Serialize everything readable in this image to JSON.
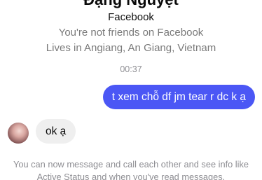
{
  "profile": {
    "name": "Đặng Nguyệt",
    "source": "Facebook",
    "friend_status": "You're not friends on Facebook",
    "location": "Lives in Angiang, An Giang, Vietnam"
  },
  "conversation": {
    "timestamp": "00:37",
    "messages": [
      {
        "direction": "outgoing",
        "text": "t xem chỗ df jm tear r dc k ạ"
      },
      {
        "direction": "incoming",
        "text": "ok ạ"
      }
    ]
  },
  "notice": {
    "text": "You can now message and call each other and see info like Active Status and when you've read messages."
  },
  "colors": {
    "outgoing_bubble": "#4b57f5",
    "incoming_bubble": "#efefef",
    "muted_text": "#7a7a7a"
  }
}
